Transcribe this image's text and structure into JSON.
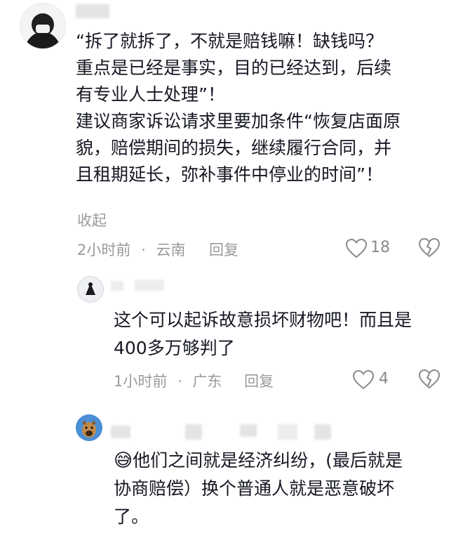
{
  "comments": [
    {
      "text_lines": [
        "“拆了就拆了，不就是赔钱嘛！缺钱吗？",
        "重点是已经是事实，目的已经达到，后续",
        "有专业人士处理”！",
        "建议商家诉讼请求里要加条件“恢复店面原",
        "貌，赔偿期间的损失，继续履行合同，并",
        "且租期延长，弥补事件中停业的时间”！"
      ],
      "collapse_label": "收起",
      "time": "2小时前",
      "location": "云南",
      "separator": "·",
      "reply_label": "回复",
      "like_count": "18"
    }
  ],
  "replies": [
    {
      "text_lines": [
        "这个可以起诉故意损坏财物吧！而且是",
        "400多万够判了"
      ],
      "time": "1小时前",
      "location": "广东",
      "separator": "·",
      "reply_label": "回复",
      "like_count": "4"
    },
    {
      "emoji": "😅",
      "text_lines": [
        "他们之间就是经济纠纷，(最后就是",
        "协商赔偿）换个普通人就是恶意破坏",
        "了。"
      ]
    }
  ],
  "colors": {
    "text": "#161823",
    "meta": "#9a9a9a",
    "blur_mask": "#e4e4e4"
  }
}
